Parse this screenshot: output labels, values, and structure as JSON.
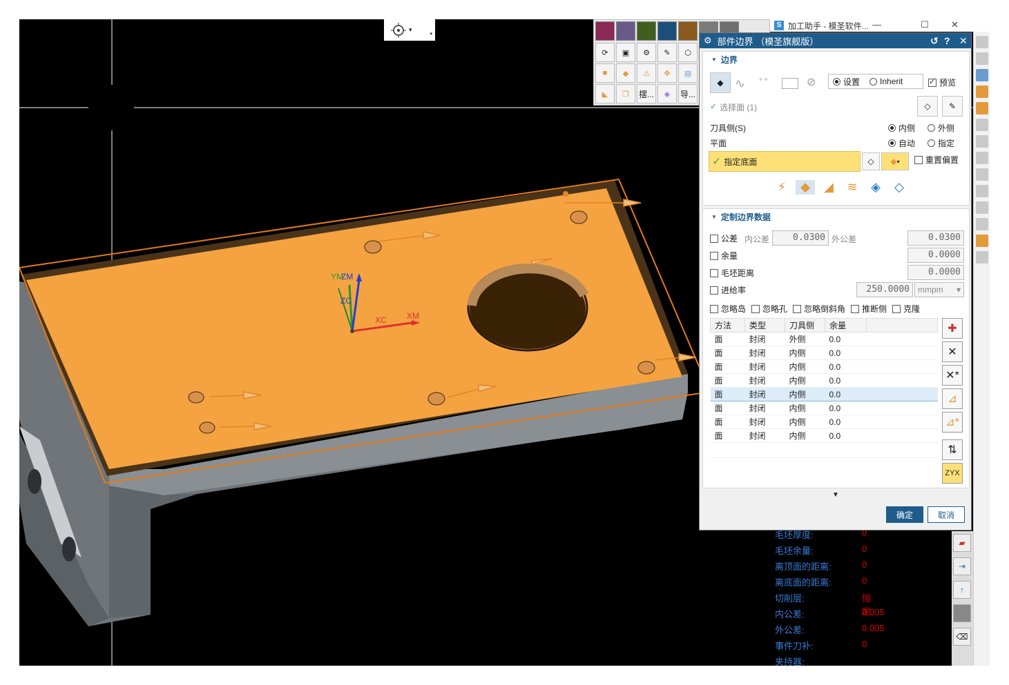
{
  "helper_window": {
    "title": "加工助手 - 模圣软件..."
  },
  "dialog": {
    "title": "部件边界 （模圣旗舰版）",
    "boundary_section": {
      "heading": "边界",
      "mode_options": [
        "设置",
        "Inherit"
      ],
      "mode_selected": "设置",
      "preview_label": "预览",
      "preview_checked": true,
      "select_face_label": "选择面 (1)",
      "tool_side_label": "刀具侧(S)",
      "tool_side_options": [
        "内侧",
        "外侧"
      ],
      "tool_side_selected": "内侧",
      "plane_label": "平面",
      "plane_options": [
        "自动",
        "指定"
      ],
      "plane_selected": "自动",
      "specify_floor_label": "指定底面",
      "reset_offset_label": "重置偏置",
      "reset_offset_checked": false
    },
    "custom_section": {
      "heading": "定制边界数据",
      "tolerance_label": "公差",
      "inner_tol_label": "内公差",
      "inner_tol_value": "0.0300",
      "outer_tol_label": "外公差",
      "outer_tol_value": "0.0300",
      "stock_label": "余量",
      "stock_value": "0.0000",
      "blank_distance_label": "毛坯距离",
      "blank_distance_value": "0.0000",
      "feed_rate_label": "进给率",
      "feed_rate_value": "250.0000",
      "feed_unit": "mmpm",
      "options": [
        "忽略岛",
        "忽略孔",
        "忽略倒斜角",
        "推断侧",
        "克隆"
      ]
    },
    "table": {
      "headers": [
        "方法",
        "类型",
        "刀具侧",
        "余量"
      ],
      "rows": [
        [
          "面",
          "封闭",
          "外侧",
          "0.0"
        ],
        [
          "面",
          "封闭",
          "内侧",
          "0.0"
        ],
        [
          "面",
          "封闭",
          "内侧",
          "0.0"
        ],
        [
          "面",
          "封闭",
          "内侧",
          "0.0"
        ],
        [
          "面",
          "封闭",
          "内侧",
          "0.0"
        ],
        [
          "面",
          "封闭",
          "内侧",
          "0.0"
        ],
        [
          "面",
          "封闭",
          "内侧",
          "0.0"
        ],
        [
          "面",
          "封闭",
          "内侧",
          "0.0"
        ]
      ],
      "selected_row": 4
    },
    "buttons": {
      "ok": "确定",
      "cancel": "取消"
    }
  },
  "float_toolbar": {
    "swatch_colors": [
      "#8a2a55",
      "#6a5a8a",
      "#3f5f1e",
      "#1e4f7a",
      "#8a5a1e",
      "#7a7a7a",
      "#6e6e6e"
    ],
    "text_buttons": [
      "摆...",
      "导..."
    ]
  },
  "axes": {
    "labels": [
      "YM",
      "ZM",
      "ZC",
      "XC",
      "XM"
    ]
  },
  "info_panel": {
    "rows": [
      {
        "label": "毛坯厚度:",
        "value": "0"
      },
      {
        "label": "毛坯余量:",
        "value": "0"
      },
      {
        "label": "离顶面的距离:",
        "value": "0"
      },
      {
        "label": "离底面的距离:",
        "value": "0"
      },
      {
        "label": "切削层:",
        "value": "恒定"
      },
      {
        "label": "内公差:",
        "value": "0.005"
      },
      {
        "label": "外公差:",
        "value": "0.005"
      },
      {
        "label": "事件刀补:",
        "value": "0"
      },
      {
        "label": "夹持器:",
        "value": ""
      }
    ]
  },
  "colors": {
    "part_top": "#f4a340",
    "part_side": "#6f7478",
    "dialog_title": "#1e5c8c",
    "highlight_yellow": "#fde178",
    "info_label": "#3a7bd5",
    "info_value": "#e00000"
  }
}
